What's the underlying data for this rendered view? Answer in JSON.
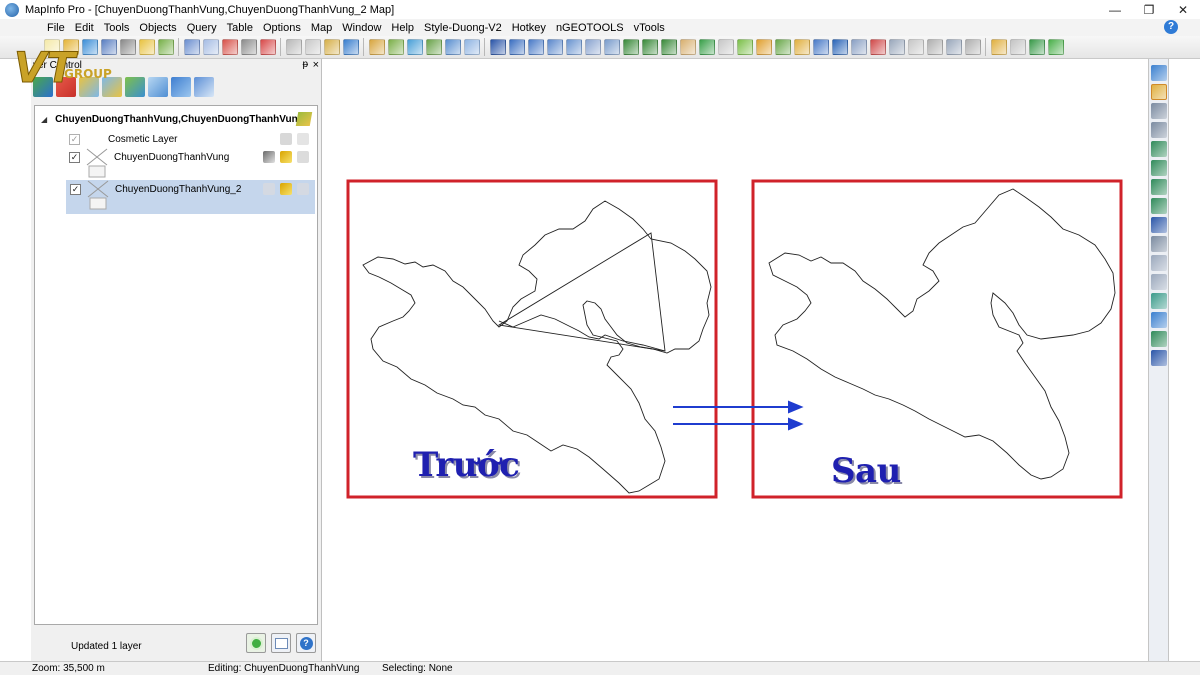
{
  "window": {
    "title": "MapInfo Pro - [ChuyenDuongThanhVung,ChuyenDuongThanhVung_2 Map]",
    "minimize_glyph": "—",
    "restore_glyph": "❐",
    "close_glyph": "✕"
  },
  "menu": {
    "items": [
      "File",
      "Edit",
      "Tools",
      "Objects",
      "Query",
      "Table",
      "Options",
      "Map",
      "Window",
      "Help",
      "Style-Duong-V2",
      "Hotkey",
      "nGEOTOOLS",
      "vTools"
    ],
    "help_glyph": "?"
  },
  "logo": {
    "text": "VT",
    "subtext": "GROUP"
  },
  "layer_control": {
    "title": "yer Control",
    "pin_glyph": "ᵽ",
    "close_glyph": "×",
    "root_label": "ChuyenDuongThanhVung,ChuyenDuongThanhVung",
    "expander_glyph": "◢",
    "layers": [
      {
        "label": "Cosmetic Layer",
        "checked": "✓"
      },
      {
        "label": "ChuyenDuongThanhVung",
        "checked": "✓"
      },
      {
        "label": "ChuyenDuongThanhVung_2",
        "checked": "✓"
      }
    ],
    "status": "Updated 1 layer",
    "info_glyph": "?"
  },
  "map": {
    "before_label": "Trước",
    "after_label": "Sau",
    "frame_color": "#d0222a",
    "arrow_color": "#1f3ccf"
  },
  "statusbar": {
    "zoom": "Zoom: 35,500 m",
    "editing": "Editing: ChuyenDuongThanhVung",
    "selecting": "Selecting: None"
  },
  "colors": {
    "accent_blue": "#1f20b0",
    "selection": "#c5d6ec"
  }
}
